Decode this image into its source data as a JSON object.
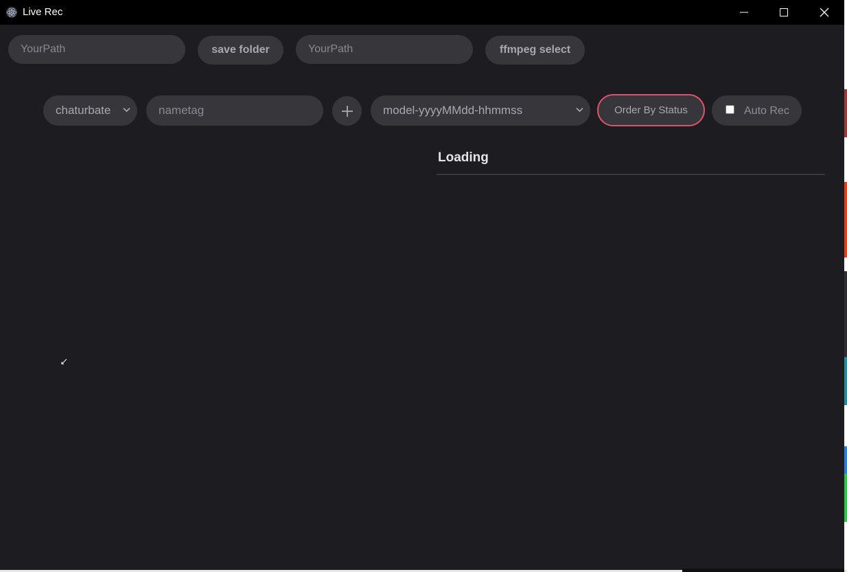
{
  "window": {
    "title": "Live Rec"
  },
  "toolbar": {
    "save_path_placeholder": "YourPath",
    "save_folder_label": "save folder",
    "ffmpeg_path_placeholder": "YourPath",
    "ffmpeg_select_label": "ffmpeg select"
  },
  "controls": {
    "platform_selected": "chaturbate",
    "nametag_placeholder": "nametag",
    "add_symbol": "+",
    "filename_format_selected": "model-yyyyMMdd-hhmmss",
    "order_label": "Order By Status",
    "auto_rec_label": "Auto Rec",
    "auto_rec_checked": false
  },
  "status": {
    "loading_text": "Loading"
  },
  "colors": {
    "background": "#1d1c21",
    "titlebar": "#000000",
    "pill": "#37363b",
    "accent_border": "#e0516e"
  }
}
